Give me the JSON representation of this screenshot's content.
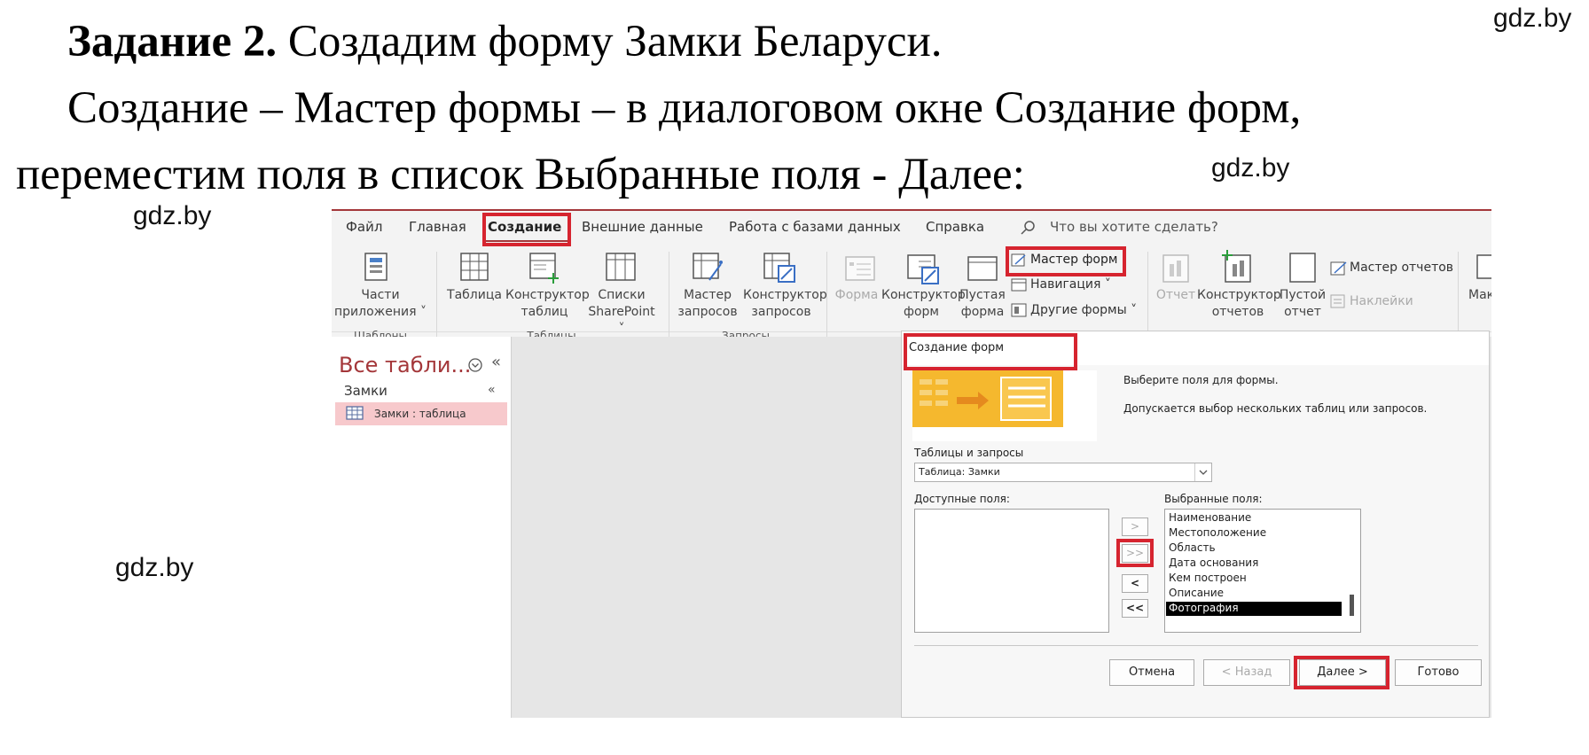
{
  "heading": {
    "task_bold": "Задание 2.",
    "task_rest": "Создадим форму Замки Беларуси.",
    "line2": "Создание – Мастер формы – в диалоговом окне Создание форм,",
    "line3": "переместим поля в список Выбранные поля - Далее:"
  },
  "watermark": "gdz.by",
  "ribbon": {
    "tabs": [
      "Файл",
      "Главная",
      "Создание",
      "Внешние данные",
      "Работа с базами данных",
      "Справка"
    ],
    "search_placeholder": "Что вы хотите сделать?",
    "templates": {
      "parts_line1": "Части",
      "parts_line2": "приложения ˅",
      "group": "Шаблоны"
    },
    "tables": {
      "table": "Таблица",
      "designer_line1": "Конструктор",
      "designer_line2": "таблиц",
      "lists_line1": "Списки",
      "lists_line2": "SharePoint ˅",
      "group": "Таблицы"
    },
    "queries": {
      "wizard_line1": "Мастер",
      "wizard_line2": "запросов",
      "designer_line1": "Конструктор",
      "designer_line2": "запросов",
      "group": "Запросы"
    },
    "forms": {
      "form": "Форма",
      "designer_line1": "Конструктор",
      "designer_line2": "форм",
      "blank_line1": "Пустая",
      "blank_line2": "форма",
      "wizard": "Мастер форм",
      "navigation": "Навигация ˅",
      "other": "Другие формы ˅"
    },
    "reports": {
      "report": "Отчет",
      "designer_line1": "Конструктор",
      "designer_line2": "отчетов",
      "blank_line1": "Пустой",
      "blank_line2": "отчет",
      "wizard": "Мастер отчетов",
      "labels": "Наклейки"
    },
    "cut_label": "Мак"
  },
  "nav_pane": {
    "title": "Все табли...",
    "group": "Замки",
    "item": "Замки : таблица"
  },
  "dialog": {
    "title": "Создание форм",
    "instr1": "Выберите поля для формы.",
    "instr2": "Допускается выбор нескольких таблиц или запросов.",
    "tables_label": "Таблицы и запросы",
    "table_value": "Таблица: Замки",
    "available_label": "Доступные поля:",
    "selected_label": "Выбранные поля:",
    "selected_fields": [
      "Наименование",
      "Местоположение",
      "Область",
      "Дата основания",
      "Кем построен",
      "Описание",
      "Фотография"
    ],
    "move_buttons": [
      ">",
      ">>",
      "<",
      "<<"
    ],
    "buttons": {
      "cancel": "Отмена",
      "back": "< Назад",
      "next": "Далее >",
      "finish": "Готово"
    }
  },
  "colors": {
    "highlight_red": "#d6242f",
    "access_red": "#a4373a",
    "nav_selected": "#f7c9cc"
  }
}
